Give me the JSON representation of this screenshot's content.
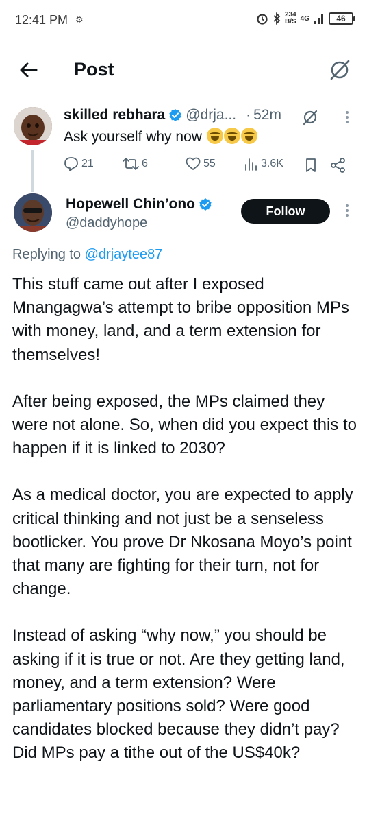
{
  "status_bar": {
    "time": "12:41 PM",
    "speed_value": "234",
    "speed_unit": "B/S",
    "network": "4G",
    "battery": "46"
  },
  "header": {
    "title": "Post"
  },
  "parent_tweet": {
    "author_name": "skilled rebhara",
    "handle": "@drja...",
    "dot": "·",
    "time": "52m",
    "text": "Ask yourself why now",
    "replies": "21",
    "reposts": "6",
    "likes": "55",
    "views": "3.6K"
  },
  "main_tweet": {
    "author_name": "Hopewell Chin’ono",
    "handle": "@daddyhope",
    "follow_label": "Follow",
    "replying_prefix": "Replying to",
    "replying_to": "@drjaytee87",
    "paragraphs": [
      "This stuff came out after I exposed Mnangagwa’s attempt to bribe opposition MPs with money, land, and a term extension for themselves!",
      "After being exposed, the MPs claimed they were not alone. So, when did you expect this to happen if it is linked to 2030?",
      "As a medical doctor, you are expected to apply critical thinking and not just be a senseless bootlicker. You prove Dr Nkosana Moyo’s point that many are fighting for their turn, not for change.",
      "Instead of asking “why now,” you should be asking if it is true or not. Are they getting land, money, and a term extension? Were parliamentary positions sold? Were good candidates blocked because they didn’t pay?",
      "Did MPs pay a tithe out of the US$40k?"
    ]
  },
  "colors": {
    "accent": "#1d9bf0",
    "text": "#0f1419",
    "muted": "#536471"
  }
}
